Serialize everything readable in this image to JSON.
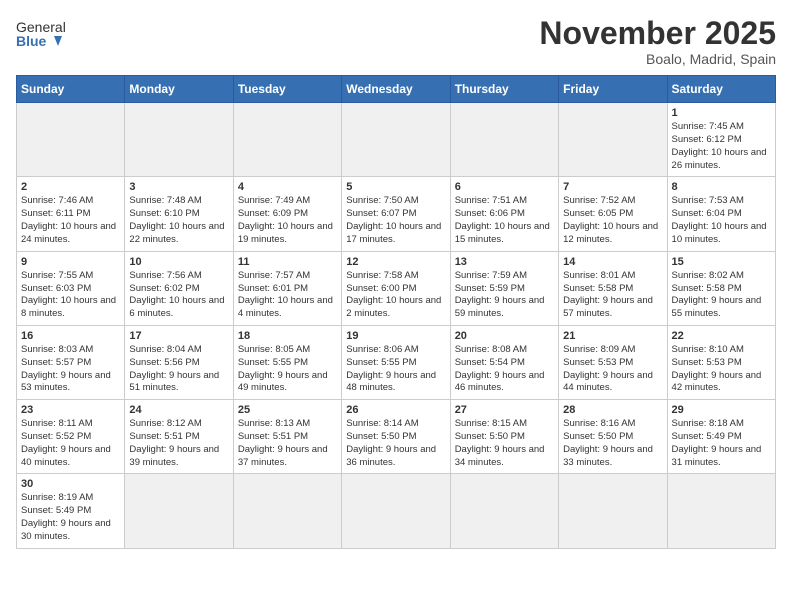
{
  "header": {
    "logo_general": "General",
    "logo_blue": "Blue",
    "month_title": "November 2025",
    "location": "Boalo, Madrid, Spain"
  },
  "weekdays": [
    "Sunday",
    "Monday",
    "Tuesday",
    "Wednesday",
    "Thursday",
    "Friday",
    "Saturday"
  ],
  "weeks": [
    [
      {
        "day": "",
        "info": ""
      },
      {
        "day": "",
        "info": ""
      },
      {
        "day": "",
        "info": ""
      },
      {
        "day": "",
        "info": ""
      },
      {
        "day": "",
        "info": ""
      },
      {
        "day": "",
        "info": ""
      },
      {
        "day": "1",
        "info": "Sunrise: 7:45 AM\nSunset: 6:12 PM\nDaylight: 10 hours and 26 minutes."
      }
    ],
    [
      {
        "day": "2",
        "info": "Sunrise: 7:46 AM\nSunset: 6:11 PM\nDaylight: 10 hours and 24 minutes."
      },
      {
        "day": "3",
        "info": "Sunrise: 7:48 AM\nSunset: 6:10 PM\nDaylight: 10 hours and 22 minutes."
      },
      {
        "day": "4",
        "info": "Sunrise: 7:49 AM\nSunset: 6:09 PM\nDaylight: 10 hours and 19 minutes."
      },
      {
        "day": "5",
        "info": "Sunrise: 7:50 AM\nSunset: 6:07 PM\nDaylight: 10 hours and 17 minutes."
      },
      {
        "day": "6",
        "info": "Sunrise: 7:51 AM\nSunset: 6:06 PM\nDaylight: 10 hours and 15 minutes."
      },
      {
        "day": "7",
        "info": "Sunrise: 7:52 AM\nSunset: 6:05 PM\nDaylight: 10 hours and 12 minutes."
      },
      {
        "day": "8",
        "info": "Sunrise: 7:53 AM\nSunset: 6:04 PM\nDaylight: 10 hours and 10 minutes."
      }
    ],
    [
      {
        "day": "9",
        "info": "Sunrise: 7:55 AM\nSunset: 6:03 PM\nDaylight: 10 hours and 8 minutes."
      },
      {
        "day": "10",
        "info": "Sunrise: 7:56 AM\nSunset: 6:02 PM\nDaylight: 10 hours and 6 minutes."
      },
      {
        "day": "11",
        "info": "Sunrise: 7:57 AM\nSunset: 6:01 PM\nDaylight: 10 hours and 4 minutes."
      },
      {
        "day": "12",
        "info": "Sunrise: 7:58 AM\nSunset: 6:00 PM\nDaylight: 10 hours and 2 minutes."
      },
      {
        "day": "13",
        "info": "Sunrise: 7:59 AM\nSunset: 5:59 PM\nDaylight: 9 hours and 59 minutes."
      },
      {
        "day": "14",
        "info": "Sunrise: 8:01 AM\nSunset: 5:58 PM\nDaylight: 9 hours and 57 minutes."
      },
      {
        "day": "15",
        "info": "Sunrise: 8:02 AM\nSunset: 5:58 PM\nDaylight: 9 hours and 55 minutes."
      }
    ],
    [
      {
        "day": "16",
        "info": "Sunrise: 8:03 AM\nSunset: 5:57 PM\nDaylight: 9 hours and 53 minutes."
      },
      {
        "day": "17",
        "info": "Sunrise: 8:04 AM\nSunset: 5:56 PM\nDaylight: 9 hours and 51 minutes."
      },
      {
        "day": "18",
        "info": "Sunrise: 8:05 AM\nSunset: 5:55 PM\nDaylight: 9 hours and 49 minutes."
      },
      {
        "day": "19",
        "info": "Sunrise: 8:06 AM\nSunset: 5:55 PM\nDaylight: 9 hours and 48 minutes."
      },
      {
        "day": "20",
        "info": "Sunrise: 8:08 AM\nSunset: 5:54 PM\nDaylight: 9 hours and 46 minutes."
      },
      {
        "day": "21",
        "info": "Sunrise: 8:09 AM\nSunset: 5:53 PM\nDaylight: 9 hours and 44 minutes."
      },
      {
        "day": "22",
        "info": "Sunrise: 8:10 AM\nSunset: 5:53 PM\nDaylight: 9 hours and 42 minutes."
      }
    ],
    [
      {
        "day": "23",
        "info": "Sunrise: 8:11 AM\nSunset: 5:52 PM\nDaylight: 9 hours and 40 minutes."
      },
      {
        "day": "24",
        "info": "Sunrise: 8:12 AM\nSunset: 5:51 PM\nDaylight: 9 hours and 39 minutes."
      },
      {
        "day": "25",
        "info": "Sunrise: 8:13 AM\nSunset: 5:51 PM\nDaylight: 9 hours and 37 minutes."
      },
      {
        "day": "26",
        "info": "Sunrise: 8:14 AM\nSunset: 5:50 PM\nDaylight: 9 hours and 36 minutes."
      },
      {
        "day": "27",
        "info": "Sunrise: 8:15 AM\nSunset: 5:50 PM\nDaylight: 9 hours and 34 minutes."
      },
      {
        "day": "28",
        "info": "Sunrise: 8:16 AM\nSunset: 5:50 PM\nDaylight: 9 hours and 33 minutes."
      },
      {
        "day": "29",
        "info": "Sunrise: 8:18 AM\nSunset: 5:49 PM\nDaylight: 9 hours and 31 minutes."
      }
    ],
    [
      {
        "day": "30",
        "info": "Sunrise: 8:19 AM\nSunset: 5:49 PM\nDaylight: 9 hours and 30 minutes."
      },
      {
        "day": "",
        "info": ""
      },
      {
        "day": "",
        "info": ""
      },
      {
        "day": "",
        "info": ""
      },
      {
        "day": "",
        "info": ""
      },
      {
        "day": "",
        "info": ""
      },
      {
        "day": "",
        "info": ""
      }
    ]
  ]
}
